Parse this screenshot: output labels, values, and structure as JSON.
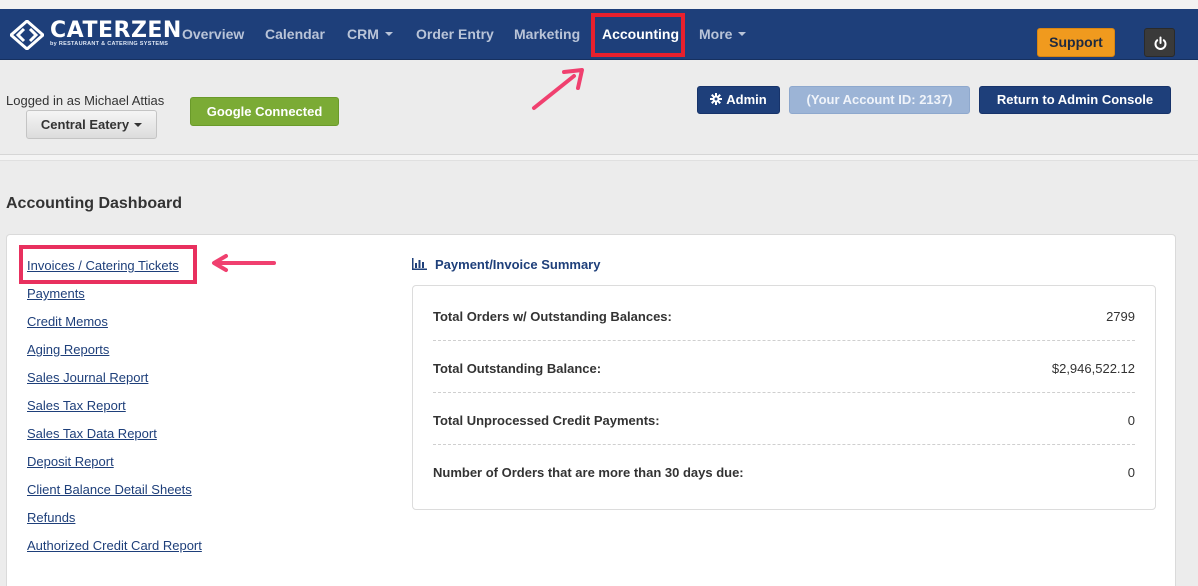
{
  "brand": {
    "name": "CATERZEN",
    "tagline": "by RESTAURANT & CATERING SYSTEMS"
  },
  "nav": {
    "items": [
      {
        "label": "Overview"
      },
      {
        "label": "Calendar"
      },
      {
        "label": "CRM"
      },
      {
        "label": "Order Entry"
      },
      {
        "label": "Marketing"
      },
      {
        "label": "Accounting"
      },
      {
        "label": "More"
      }
    ],
    "support_label": "Support",
    "power_icon": "power-icon"
  },
  "account": {
    "logged_in_text": "Logged in as Michael Attias",
    "location_label": "Central Eatery",
    "google_label": "Google Connected",
    "admin_label": "Admin",
    "account_id_label": "(Your Account ID: 2137)",
    "return_label": "Return to Admin Console"
  },
  "page": {
    "title": "Accounting Dashboard"
  },
  "links": [
    "Invoices / Catering Tickets",
    "Payments",
    "Credit Memos",
    "Aging Reports",
    "Sales Journal Report",
    "Sales Tax Report",
    "Sales Tax Data Report",
    "Deposit Report",
    "Client Balance Detail Sheets",
    "Refunds",
    "Authorized Credit Card Report"
  ],
  "summary": {
    "title": "Payment/Invoice Summary",
    "rows": [
      {
        "label": "Total Orders w/ Outstanding Balances:",
        "value": "2799"
      },
      {
        "label": "Total Outstanding Balance:",
        "value": "$2,946,522.12"
      },
      {
        "label": "Total Unprocessed Credit Payments:",
        "value": "0"
      },
      {
        "label": "Number of Orders that are more than 30 days due:",
        "value": "0"
      }
    ]
  },
  "colors": {
    "navbar": "#1e3f7a",
    "support": "#f09a1e",
    "google": "#7bab35",
    "annotation_red": "#e8202d",
    "annotation_pink": "#e8305e"
  }
}
